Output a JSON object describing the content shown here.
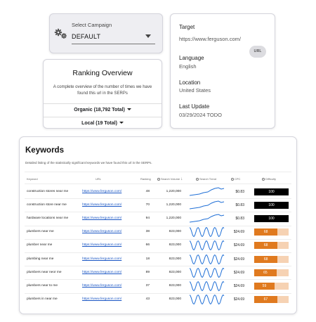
{
  "campaign": {
    "label": "Select Campaign",
    "value": "DEFAULT"
  },
  "ranking": {
    "title": "Ranking Overview",
    "description": "A complete overview of the number of times we have found this url in the SERPs",
    "organic": "Organic (18,792 Total)",
    "local": "Local (19 Total)"
  },
  "target": {
    "target_label": "Target",
    "target_value": "https://www.ferguson.com/",
    "url_chip": "URL",
    "language_label": "Language",
    "language_value": "English",
    "location_label": "Location",
    "location_value": "United States",
    "update_label": "Last Update",
    "update_value": "03/29/2024 TODO"
  },
  "keywords": {
    "title": "Keywords",
    "subtitle": "Detailed listing of the statistically significant keywords we have found this url in the SERPs.",
    "headers": {
      "keyword": "Keyword",
      "url": "URL",
      "ranking": "Ranking",
      "volume": "Search Volume",
      "trend": "Search Trend",
      "cpc": "CPC",
      "difficulty": "Difficulty"
    },
    "rows": [
      {
        "keyword": "construction stores near me",
        "url": "https://www.ferguson.com/",
        "ranking": "48",
        "volume": "1,220,000",
        "cpc": "$0.83",
        "difficulty": "100",
        "trend": "flat"
      },
      {
        "keyword": "construction store near me",
        "url": "https://www.ferguson.com/",
        "ranking": "70",
        "volume": "1,220,000",
        "cpc": "$0.83",
        "difficulty": "100",
        "trend": "flat"
      },
      {
        "keyword": "hardware locations near me",
        "url": "https://www.ferguson.com/",
        "ranking": "94",
        "volume": "1,220,000",
        "cpc": "$0.83",
        "difficulty": "100",
        "trend": "flat"
      },
      {
        "keyword": "plumbers near me",
        "url": "https://www.ferguson.com/",
        "ranking": "38",
        "volume": "823,000",
        "cpc": "$24.69",
        "difficulty": "68",
        "trend": "wave"
      },
      {
        "keyword": "plumber near me",
        "url": "https://www.ferguson.com/",
        "ranking": "66",
        "volume": "823,000",
        "cpc": "$24.69",
        "difficulty": "68",
        "trend": "wave"
      },
      {
        "keyword": "plumbing near me",
        "url": "https://www.ferguson.com/",
        "ranking": "18",
        "volume": "823,000",
        "cpc": "$24.69",
        "difficulty": "68",
        "trend": "wave"
      },
      {
        "keyword": "plumbers near neor me",
        "url": "https://www.ferguson.com/",
        "ranking": "89",
        "volume": "823,000",
        "cpc": "$24.69",
        "difficulty": "65",
        "trend": "wave"
      },
      {
        "keyword": "plumbers near to me",
        "url": "https://www.ferguson.com/",
        "ranking": "37",
        "volume": "823,000",
        "cpc": "$24.69",
        "difficulty": "59",
        "trend": "wave"
      },
      {
        "keyword": "plumbers in near me",
        "url": "https://www.ferguson.com/",
        "ranking": "43",
        "volume": "823,000",
        "cpc": "$24.69",
        "difficulty": "67",
        "trend": "wave"
      }
    ]
  },
  "colors": {
    "link": "#1a56c4",
    "spark": "#1f6fd6",
    "diff_high": "#000000",
    "diff_mid": "#e07a1f",
    "diff_track": "#f6d2b3"
  }
}
